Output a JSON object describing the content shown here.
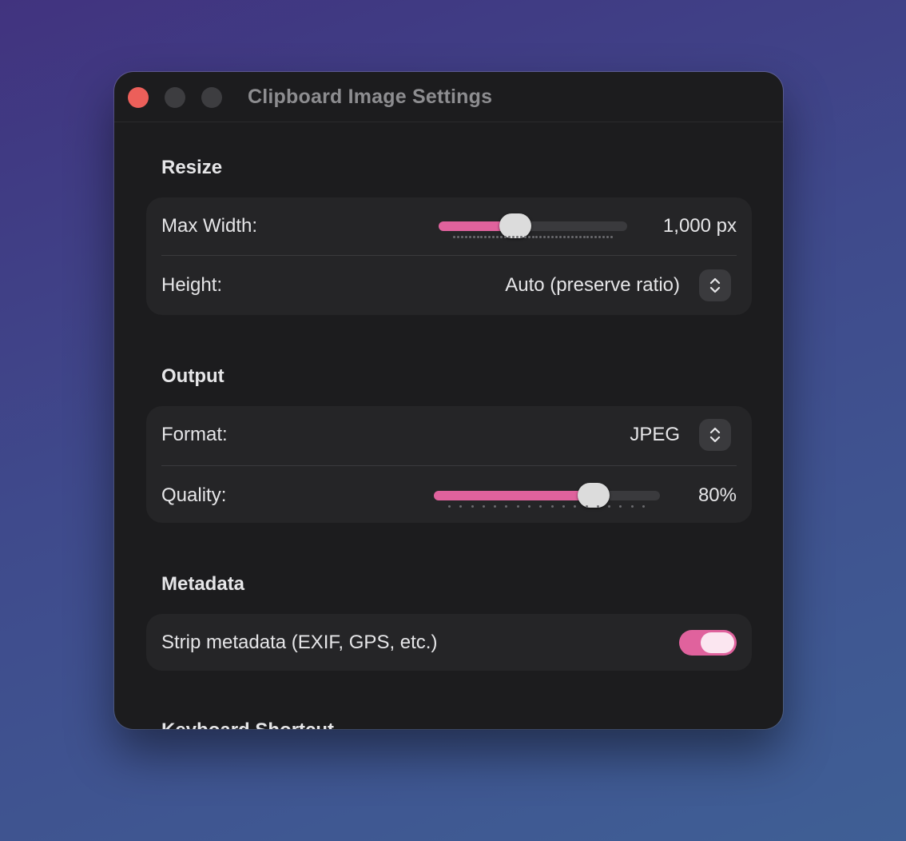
{
  "window": {
    "title": "Clipboard Image Settings"
  },
  "sections": {
    "resize": {
      "title": "Resize",
      "max_width": {
        "label": "Max Width:",
        "value": "1,000 px",
        "slider_fraction": 0.39
      },
      "height": {
        "label": "Height:",
        "value": "Auto (preserve ratio)",
        "icon": "chevron-up-down-icon"
      }
    },
    "output": {
      "title": "Output",
      "format": {
        "label": "Format:",
        "value": "JPEG",
        "icon": "chevron-up-down-icon"
      },
      "quality": {
        "label": "Quality:",
        "value": "80%",
        "slider_fraction": 0.74
      }
    },
    "metadata": {
      "title": "Metadata",
      "strip": {
        "label": "Strip metadata (EXIF, GPS, etc.)",
        "enabled": true
      }
    },
    "keyboard_shortcut": {
      "title": "Keyboard Shortcut"
    }
  },
  "colors": {
    "accent": "#e0629d",
    "window_bg": "#1c1c1e",
    "card_bg": "#252527",
    "close_button": "#ec5f5a"
  }
}
